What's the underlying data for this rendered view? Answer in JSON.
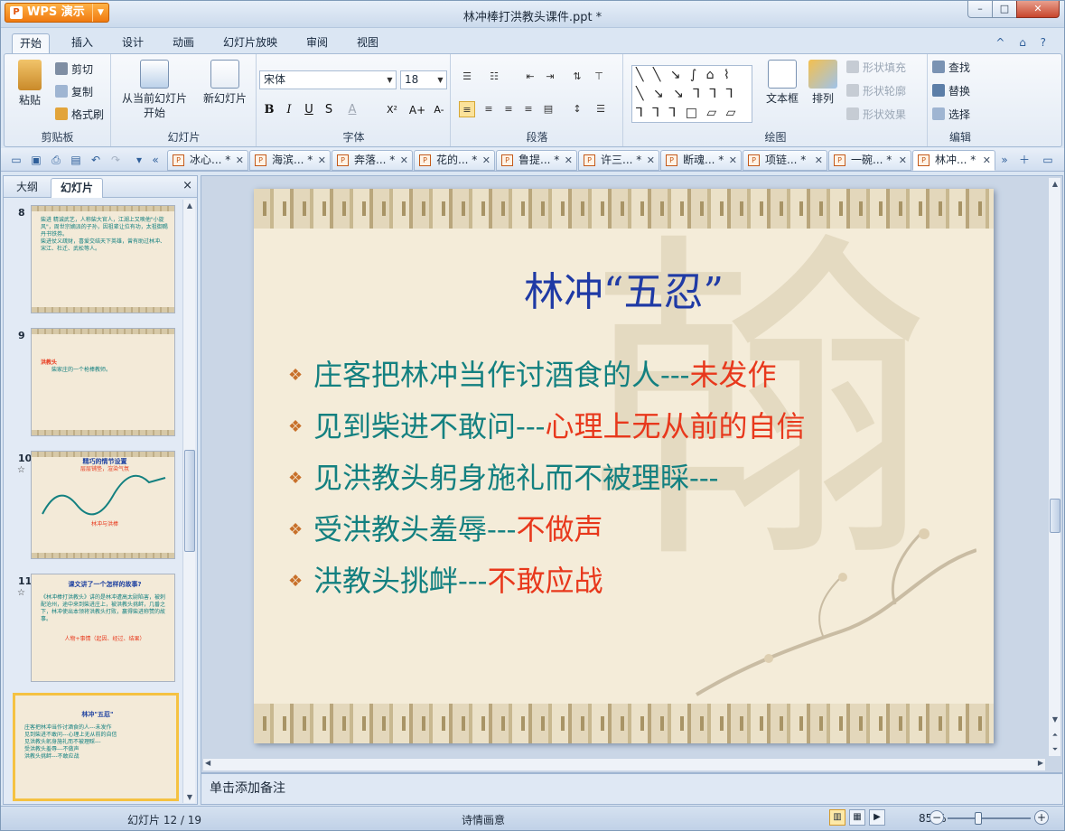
{
  "window": {
    "app_button": "WPS 演示",
    "title": "林冲棒打洪教头课件.ppt *",
    "min": "–",
    "max": "□",
    "close": "✕"
  },
  "menu": {
    "tabs": [
      "开始",
      "插入",
      "设计",
      "动画",
      "幻灯片放映",
      "审阅",
      "视图"
    ],
    "active": 0,
    "help_icons": "^ ⌂ ?"
  },
  "ribbon": {
    "clipboard": {
      "label": "剪贴板",
      "paste": "粘贴",
      "cut": "剪切",
      "copy": "复制",
      "format_painter": "格式刷"
    },
    "slides": {
      "label": "幻灯片",
      "from_current_line1": "从当前幻灯片",
      "from_current_line2": "开始",
      "new_slide": "新幻灯片"
    },
    "font": {
      "label": "字体",
      "font_name": "宋体",
      "font_size": "18",
      "bold": "B",
      "italic": "I",
      "underline": "U",
      "strike": "S",
      "color": "A",
      "superscript": "X²",
      "grow": "A+",
      "shrink": "A-"
    },
    "paragraph": {
      "label": "段落"
    },
    "drawing": {
      "label": "绘图",
      "textbox": "文本框",
      "arrange": "排列",
      "shape_fill": "形状填充",
      "shape_outline": "形状轮廓",
      "shape_effect": "形状效果",
      "gallery_row1": "╲ ╲ ↘ ∫ ⌂ ⌇",
      "gallery_row2": "╲ ↘ ↘ ⅂ ⅂ ⅂",
      "gallery_row3": "⅂ ⅂ ⅂ □ ▱ ▱"
    },
    "edit": {
      "label": "编辑",
      "find": "查找",
      "replace": "替换",
      "select": "选择"
    }
  },
  "doc_tabs": [
    "冰心... *",
    "海滨... *",
    "奔落... *",
    "花的... *",
    "鲁提... *",
    "许三... *",
    "断魂... *",
    "项链... *",
    "一碗... *",
    "林冲... *"
  ],
  "left_panel": {
    "tab_outline": "大纲",
    "tab_slides": "幻灯片",
    "close": "×",
    "thumbs": [
      {
        "num": "8",
        "star": "",
        "title": "",
        "lines": [
          "柴进 精诚武艺，人称柴大官人，江湖上又唤他\"小旋风\"，周世宗嫡派的子孙，因祖辈让位有功，太祖御赐丹书铁券。",
          "柴进仗义疏财，喜爱交结天下英雄，曾有助过林冲、宋江、杜迁、武松等人。"
        ],
        "accent": ""
      },
      {
        "num": "9",
        "star": "",
        "title": "",
        "lines": [
          "洪教头",
          "柴家庄的一个枪棒教师。"
        ],
        "accent": ""
      },
      {
        "num": "10",
        "star": "☆",
        "title": "精巧的情节设置",
        "lines": [
          "层层铺垫，渲染气氛"
        ],
        "accent": "林冲与洪棒"
      },
      {
        "num": "11",
        "star": "☆",
        "title": "课文讲了一个怎样的故事?",
        "lines": [
          "《林冲棒打洪教头》讲的是林冲遭高太尉陷害，被刺配沧州，途中来到柴进庄上，被洪教头挑衅，几番之下，林冲使出本领将洪教头打败，赢得柴进称赞的故事。"
        ],
        "accent": "人物+事情（起因、经过、结果）"
      },
      {
        "num": "12",
        "star": "",
        "title": "林冲\"五忍\"",
        "lines": [
          "庄客把林冲当作讨酒食的人---未发作",
          "见到柴进不敢问---心理上无从前的自信",
          "见洪教头躬身施礼而不被理睬---",
          "受洪教头羞辱---不做声",
          "洪教头挑衅---不敢应战"
        ],
        "accent": ""
      }
    ]
  },
  "slide": {
    "title": "林冲“五忍”",
    "bullets": [
      {
        "text": "庄客把林冲当作讨酒食的人---",
        "red": "未发作"
      },
      {
        "text": "见到柴进不敢问---",
        "red": "心理上无从前的自信"
      },
      {
        "text": "见洪教头躬身施礼而不被理睬---",
        "red": ""
      },
      {
        "text": "受洪教头羞辱---",
        "red": "不做声"
      },
      {
        "text": "洪教头挑衅---",
        "red": "不敢应战"
      }
    ],
    "colors": {
      "title": "#1f3aa5",
      "body": "#138080",
      "highlight": "#e8381c",
      "bullet": "#c8702a",
      "background": "#f4ecd9"
    }
  },
  "notes": {
    "placeholder": "单击添加备注"
  },
  "status": {
    "slide_counter": "幻灯片 12 / 19",
    "theme": "诗情画意",
    "zoom": "85 %",
    "zoom_fraction": 0.5
  }
}
